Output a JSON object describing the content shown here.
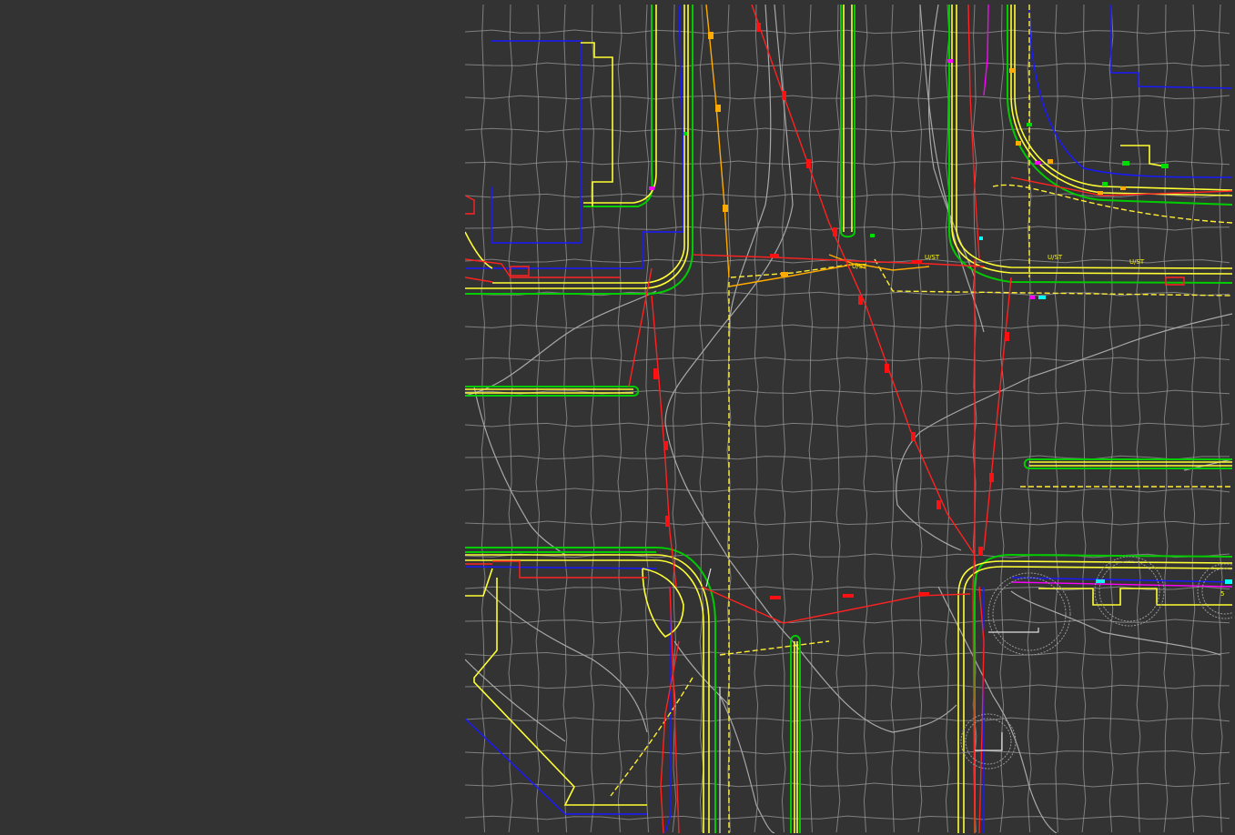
{
  "drawing": {
    "background": "#333333",
    "layers": [
      {
        "name": "surface-grid",
        "color": "#a0a0a0"
      },
      {
        "name": "curb-edge",
        "color": "#ffff00"
      },
      {
        "name": "back-of-curb",
        "color": "#00cc00"
      },
      {
        "name": "property-line",
        "color": "#1a1aff"
      },
      {
        "name": "utility",
        "color": "#ff0000"
      },
      {
        "name": "conduit",
        "color": "#ffaa00"
      },
      {
        "name": "misc-magenta",
        "color": "#ff00ff"
      },
      {
        "name": "misc-cyan",
        "color": "#00ffff"
      }
    ],
    "labels": [
      {
        "id": "lbl-1",
        "text": "U/ST",
        "color": "#ffff00"
      },
      {
        "id": "lbl-2",
        "text": "U/ST",
        "color": "#ffff00"
      },
      {
        "id": "lbl-3",
        "text": "U/ST",
        "color": "#ffff00"
      },
      {
        "id": "lbl-4",
        "text": "U/ST",
        "color": "#ffff00"
      },
      {
        "id": "lbl-5",
        "text": "5",
        "color": "#ffff00"
      }
    ]
  }
}
